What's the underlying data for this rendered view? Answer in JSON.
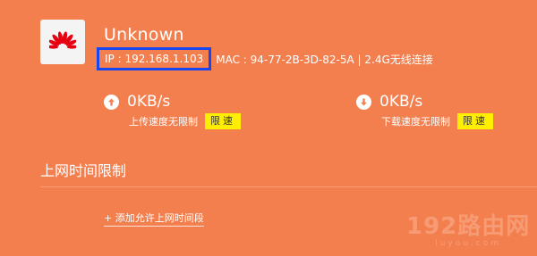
{
  "device": {
    "name": "Unknown",
    "ip": "IP : 192.168.1.103",
    "details": "MAC : 94-77-2B-3D-82-5A | 2.4G无线连接"
  },
  "upload": {
    "value": "0KB/s",
    "label": "上传速度无限制",
    "limit_button": "限速"
  },
  "download": {
    "value": "0KB/s",
    "label": "下载速度无限制",
    "limit_button": "限速"
  },
  "time_limit": {
    "title": "上网时间限制",
    "add_link": "+ 添加允许上网时间段"
  },
  "watermark": {
    "main": "192路由网",
    "sub": "luyou.com"
  },
  "colors": {
    "background": "#f47f4e",
    "highlight_box": "#1746f0",
    "limit_button": "#ffee00",
    "brand_logo": "#e60012"
  }
}
